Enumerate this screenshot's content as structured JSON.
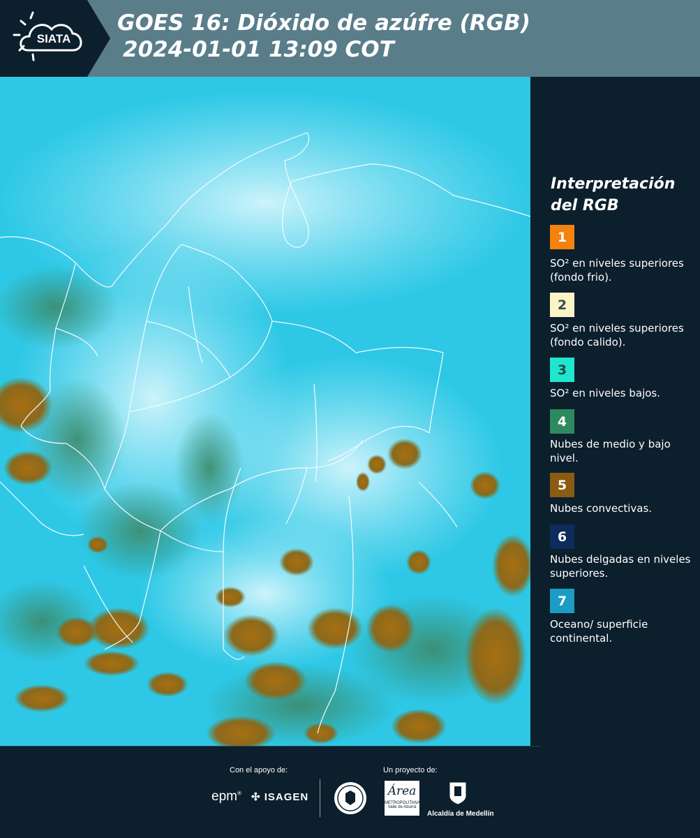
{
  "header": {
    "logo_text": "SIATA",
    "title_line1": "GOES 16: Dióxido de azúfre (RGB)",
    "title_line2": "2024-01-01 13:09 COT"
  },
  "legend": {
    "title_line1": "Interpretación",
    "title_line2": "del RGB",
    "items": [
      {
        "number": "1",
        "color": "#f5820f",
        "label": "SO² en niveles superiores (fondo frio)."
      },
      {
        "number": "2",
        "color": "#fbf4c6",
        "label": "SO² en niveles superiores (fondo calido)."
      },
      {
        "number": "3",
        "color": "#1fe6cf",
        "label": "SO² en niveles bajos."
      },
      {
        "number": "4",
        "color": "#2c8a5e",
        "label": "Nubes de medio y bajo nivel."
      },
      {
        "number": "5",
        "color": "#8a5b10",
        "label": "Nubes convectivas."
      },
      {
        "number": "6",
        "color": "#0d2b5c",
        "label": "Nubes delgadas en niveles superiores."
      },
      {
        "number": "7",
        "color": "#1b9cc4",
        "label": "Oceano/ superficie continental."
      }
    ]
  },
  "footer": {
    "support_label": "Con el apoyo de:",
    "project_label": "Un proyecto de:",
    "epm": "epm",
    "isagen": "ISAGEN",
    "area_name": "Área",
    "area_sub1": "METROPOLITANA",
    "area_sub2": "Valle de Aburrá",
    "alcaldia": "Alcaldía de Medellín"
  },
  "colors": {
    "header_bg": "#5a7d8a",
    "page_bg": "#0c1f2c",
    "ocean_cyan": "#2ec8e6",
    "cloud_white": "#d8f4fa",
    "convective_brown": "#8a6a1e"
  }
}
